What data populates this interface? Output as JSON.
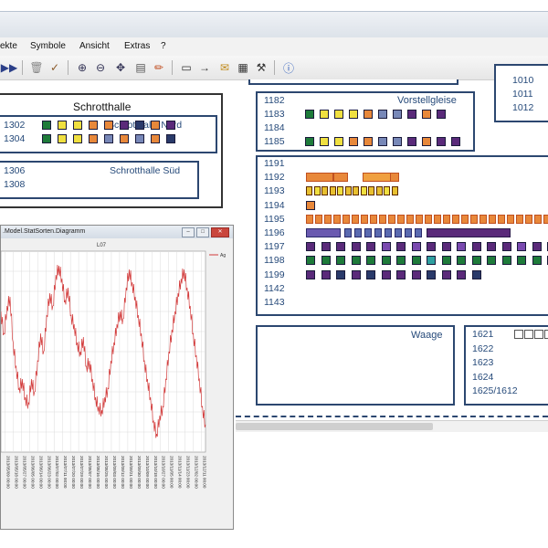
{
  "menu": {
    "items": [
      "ekte",
      "Symbole",
      "Ansicht",
      "Extras",
      "?"
    ]
  },
  "toolbar": {
    "icons": [
      "fast-forward-icon",
      "trash-icon",
      "broom-icon",
      "zoom-in-icon",
      "zoom-out-icon",
      "fit-icon",
      "print-icon",
      "pencil-icon",
      "eraser-icon",
      "arrow-icon",
      "comment-icon",
      "grid-icon",
      "tools-icon",
      "help-icon"
    ]
  },
  "yards": {
    "schrotthalle": {
      "title": "Schrotthalle",
      "nord_label": "Schrotthalle Nord",
      "sued_label": "Schrotthalle Süd",
      "tracks_nord": [
        {
          "num": "1302",
          "wagons": [
            "#1e7b3a",
            "#f0e040",
            "#f0e040",
            "#e8883a",
            "#e8883a",
            "#5a2a7a",
            "#2a3a6a",
            "#e8883a",
            "#5a2a7a"
          ]
        },
        {
          "num": "1304",
          "wagons": [
            "#1e7b3a",
            "#f0e040",
            "#f0e040",
            "#e8883a",
            "#7888b8",
            "#e8883a",
            "#7888b8",
            "#e8883a",
            "#2a3a6a"
          ]
        }
      ],
      "tracks_sued": [
        "1306",
        "1308"
      ]
    },
    "vorstellgleise": {
      "title": "Vorstellgleise",
      "tracks": [
        {
          "num": "1182",
          "wagons": []
        },
        {
          "num": "1183",
          "wagons": [
            "#1e7b3a",
            "#f0e040",
            "#f0e040",
            "#f0e040",
            "#e8883a",
            "#7888b8",
            "#7888b8",
            "#5a2a7a",
            "#e8883a",
            "#5a2a7a"
          ]
        },
        {
          "num": "1184",
          "wagons": []
        },
        {
          "num": "1185",
          "wagons": [
            "#1e7b3a",
            "#f0e040",
            "#f0e040",
            "#e8883a",
            "#e8883a",
            "#7888b8",
            "#7888b8",
            "#5a2a7a",
            "#e8883a",
            "#5a2a7a",
            "#5a2a7a"
          ]
        }
      ]
    },
    "top_right": {
      "tracks": [
        "1010",
        "1011",
        "1012"
      ]
    },
    "main": {
      "tracks": [
        {
          "num": "1191",
          "wagons": [],
          "special": "1191"
        },
        {
          "num": "1192",
          "wagons": [],
          "special": "1192"
        },
        {
          "num": "1193",
          "wagons": [],
          "special": "1193"
        },
        {
          "num": "1194",
          "wagons": [
            "#e8883a"
          ]
        },
        {
          "num": "1195",
          "wagons": [],
          "special": "1195"
        },
        {
          "num": "1196",
          "wagons": [],
          "special": "1196"
        },
        {
          "num": "1197",
          "wagons": [
            "#5a2a7a",
            "#5a2a7a",
            "#5a2a7a",
            "#5a2a7a",
            "#5a2a7a",
            "#7a4ab0",
            "#5a2a7a",
            "#7a4ab0",
            "#5a2a7a",
            "#5a2a7a",
            "#7a4ab0",
            "#5a2a7a",
            "#5a2a7a",
            "#5a2a7a",
            "#7a4ab0",
            "#5a2a7a",
            "#7a4ab0"
          ]
        },
        {
          "num": "1198",
          "wagons": [
            "#1e7b3a",
            "#1e7b3a",
            "#1e7b3a",
            "#1e7b3a",
            "#1e7b3a",
            "#1e7b3a",
            "#1e7b3a",
            "#1e7b3a",
            "#2ea0a0",
            "#1e7b3a",
            "#1e7b3a",
            "#1e7b3a",
            "#1e7b3a",
            "#1e7b3a",
            "#1e7b3a",
            "#1e7b3a",
            "#1e7b3a"
          ]
        },
        {
          "num": "1199",
          "wagons": [
            "#5a2a7a",
            "#5a2a7a",
            "#2a3a6a",
            "#5a2a7a",
            "#2a3a6a",
            "#5a2a7a",
            "#5a2a7a",
            "#5a2a7a",
            "#2a3a6a",
            "#5a2a7a",
            "#5a2a7a",
            "#2a3a6a"
          ]
        },
        {
          "num": "1142",
          "wagons": []
        },
        {
          "num": "1143",
          "wagons": []
        }
      ]
    },
    "waage": {
      "title": "Waage"
    },
    "bottom_right": {
      "tracks": [
        "1621",
        "1622",
        "1623",
        "1624",
        "1625/1612"
      ]
    }
  },
  "chart_window": {
    "title": ".Model.StatSorten.Diagramm",
    "header": "L07",
    "legend_label": "Ag",
    "x_tick_labels": [
      "2013/05/09 00:00",
      "2013/05/18 00:00",
      "2013/05/27 00:00",
      "2013/06/05 00:00",
      "2013/06/14 00:00",
      "2013/06/23 00:00",
      "2013/07/02 00:00",
      "2013/07/11 00:00",
      "2013/07/20 00:00",
      "2013/07/29 00:00",
      "2013/08/07 00:00",
      "2013/08/16 00:00",
      "2013/08/25 00:00",
      "2013/09/03 00:00",
      "2013/09/12 00:00",
      "2013/09/21 00:00",
      "2013/09/30 00:00",
      "2013/10/09 00:00",
      "2013/10/18 00:00",
      "2013/10/27 00:00",
      "2013/11/05 00:00",
      "2013/11/14 00:00",
      "2013/11/23 00:00",
      "2013/12/02 00:00",
      "2013/12/11 00:00"
    ]
  },
  "chart_data": {
    "type": "line",
    "series": [
      {
        "values": [
          0.72,
          0.6,
          0.75,
          0.8,
          0.55,
          0.42,
          0.3,
          0.35,
          0.25,
          0.22,
          0.35,
          0.28,
          0.45,
          0.6,
          0.5,
          0.7,
          0.82,
          0.75,
          0.92,
          0.97,
          0.9,
          0.78,
          0.85,
          0.7,
          0.65,
          0.55,
          0.5,
          0.58,
          0.42,
          0.45,
          0.35,
          0.25,
          0.2,
          0.18,
          0.25,
          0.3,
          0.45,
          0.55,
          0.65,
          0.72,
          0.68,
          0.85,
          0.95,
          0.88,
          0.8,
          0.7,
          0.6,
          0.45,
          0.35,
          0.25,
          0.12,
          0.05,
          0.15,
          0.2,
          0.35,
          0.5,
          0.62,
          0.72,
          0.82,
          0.9,
          0.95,
          0.85,
          0.75,
          0.6,
          0.48,
          0.35,
          0.2,
          0.1
        ]
      }
    ]
  },
  "colors": {
    "accent": "#2c4770",
    "track_text": "#264a7a",
    "line": "#d23a3a"
  }
}
